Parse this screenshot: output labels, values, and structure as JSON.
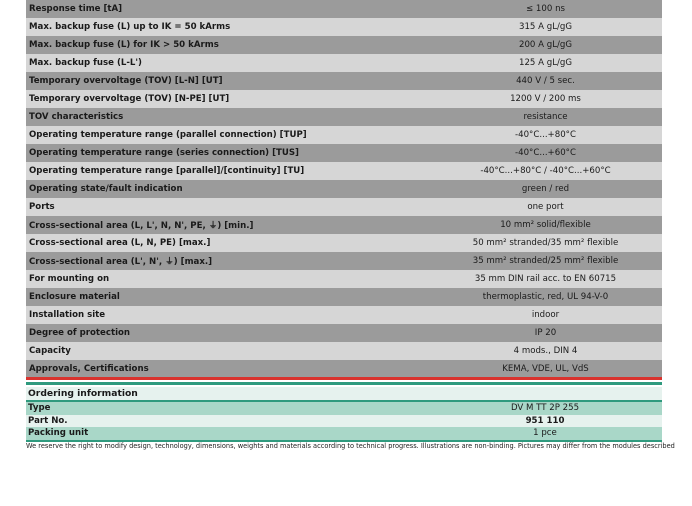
{
  "specs": [
    {
      "label": "Response time [tA]",
      "value": "≤ 100 ns",
      "shade": "dark"
    },
    {
      "label": "Max. backup fuse (L) up to IK = 50 kArms",
      "value": "315 A gL/gG",
      "shade": "light"
    },
    {
      "label": "Max. backup fuse (L) for IK > 50 kArms",
      "value": "200 A gL/gG",
      "shade": "dark"
    },
    {
      "label": "Max. backup fuse (L-L')",
      "value": "125 A gL/gG",
      "shade": "light"
    },
    {
      "label": "Temporary overvoltage (TOV) [L-N] [UT]",
      "value": "440 V / 5 sec.",
      "shade": "dark"
    },
    {
      "label": "Temporary overvoltage (TOV) [N-PE] [UT]",
      "value": "1200 V / 200 ms",
      "shade": "light"
    },
    {
      "label": "TOV characteristics",
      "value": "resistance",
      "shade": "dark"
    },
    {
      "label": "Operating temperature range (parallel connection) [TUP]",
      "value": "-40°C...+80°C",
      "shade": "light"
    },
    {
      "label": "Operating temperature range (series connection) [TUS]",
      "value": "-40°C...+60°C",
      "shade": "dark"
    },
    {
      "label": "Operating temperature range [parallel]/[continuity] [TU]",
      "value": "-40°C...+80°C / -40°C...+60°C",
      "shade": "light"
    },
    {
      "label": "Operating state/fault indication",
      "value": "green / red",
      "shade": "dark"
    },
    {
      "label": "Ports",
      "value": "one port",
      "shade": "light"
    },
    {
      "label": "Cross-sectional area (L, L', N, N', PE, ⏚) [min.]",
      "value": "10 mm² solid/flexible",
      "shade": "dark"
    },
    {
      "label": "Cross-sectional area (L, N, PE) [max.]",
      "value": "50 mm² stranded/35 mm² flexible",
      "shade": "light"
    },
    {
      "label": "Cross-sectional area (L', N', ⏚) [max.]",
      "value": "35 mm² stranded/25 mm² flexible",
      "shade": "dark"
    },
    {
      "label": "For mounting on",
      "value": "35 mm DIN rail acc. to EN 60715",
      "shade": "light"
    },
    {
      "label": "Enclosure material",
      "value": "thermoplastic, red, UL 94-V-0",
      "shade": "dark"
    },
    {
      "label": "Installation site",
      "value": "indoor",
      "shade": "light"
    },
    {
      "label": "Degree of protection",
      "value": "IP 20",
      "shade": "dark"
    },
    {
      "label": "Capacity",
      "value": "4 mods., DIN 4",
      "shade": "light"
    },
    {
      "label": "Approvals, Certifications",
      "value": "KEMA, VDE, UL, VdS",
      "shade": "dark"
    }
  ],
  "ordering": {
    "title": "Ordering information",
    "rows": [
      {
        "label": "Type",
        "value": "DV M TT 2P 255"
      },
      {
        "label": "Part No.",
        "value": "951 110"
      },
      {
        "label": "Packing unit",
        "value": "1 pce"
      }
    ]
  },
  "disclaimer": "We reserve the right to modify design, technology, dimensions, weights and materials according to technical progress. Illustrations are non-binding. Pictures may differ from the modules described",
  "colors": {
    "accent_red": "#d9332e",
    "accent_teal": "#2f9a7e"
  }
}
